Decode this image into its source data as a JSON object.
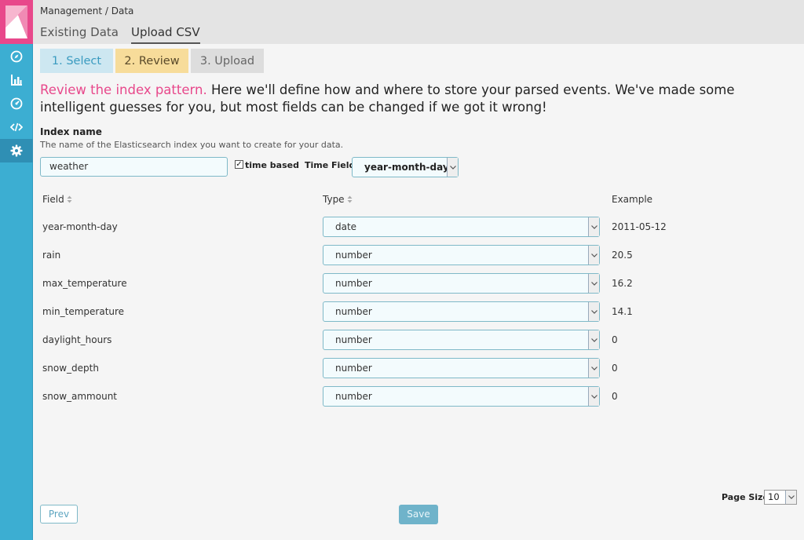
{
  "breadcrumb": {
    "parent": "Management",
    "separator": " / ",
    "current": "Data"
  },
  "tabs": [
    {
      "label": "Existing Data",
      "active": false
    },
    {
      "label": "Upload CSV",
      "active": true
    }
  ],
  "steps": [
    {
      "label": "1. Select",
      "state": "done"
    },
    {
      "label": "2. Review",
      "state": "current"
    },
    {
      "label": "3. Upload",
      "state": "pending"
    }
  ],
  "intro": {
    "highlight": "Review the index pattern.",
    "text": " Here we'll define how and where to store your parsed events. We've made some intelligent guesses for you, but most fields can be changed if we got it wrong!"
  },
  "index": {
    "label": "Index name",
    "help": "The name of the Elasticsearch index you want to create for your data.",
    "value": "weather"
  },
  "time_based": {
    "label": "time based",
    "checked": true
  },
  "time_field": {
    "label": "Time Field",
    "value": "year-month-day"
  },
  "table": {
    "headers": {
      "field": "Field",
      "type": "Type",
      "example": "Example"
    },
    "rows": [
      {
        "field": "year-month-day",
        "type": "date",
        "example": "2011-05-12"
      },
      {
        "field": "rain",
        "type": "number",
        "example": "20.5"
      },
      {
        "field": "max_temperature",
        "type": "number",
        "example": "16.2"
      },
      {
        "field": "min_temperature",
        "type": "number",
        "example": "14.1"
      },
      {
        "field": "daylight_hours",
        "type": "number",
        "example": "0"
      },
      {
        "field": "snow_depth",
        "type": "number",
        "example": "0"
      },
      {
        "field": "snow_ammount",
        "type": "number",
        "example": "0"
      }
    ]
  },
  "page_size": {
    "label": "Page Size",
    "value": "10"
  },
  "buttons": {
    "prev": "Prev",
    "save": "Save"
  },
  "sidebar": {
    "items": [
      {
        "icon": "compass-icon"
      },
      {
        "icon": "bar-chart-icon"
      },
      {
        "icon": "dashboard-icon"
      },
      {
        "icon": "code-icon"
      },
      {
        "icon": "gear-icon",
        "active": true
      }
    ]
  },
  "colors": {
    "accent": "#e8488b",
    "sidebar": "#3caed2",
    "step_current": "#f7dc9a",
    "step_done": "#cde7f1"
  }
}
